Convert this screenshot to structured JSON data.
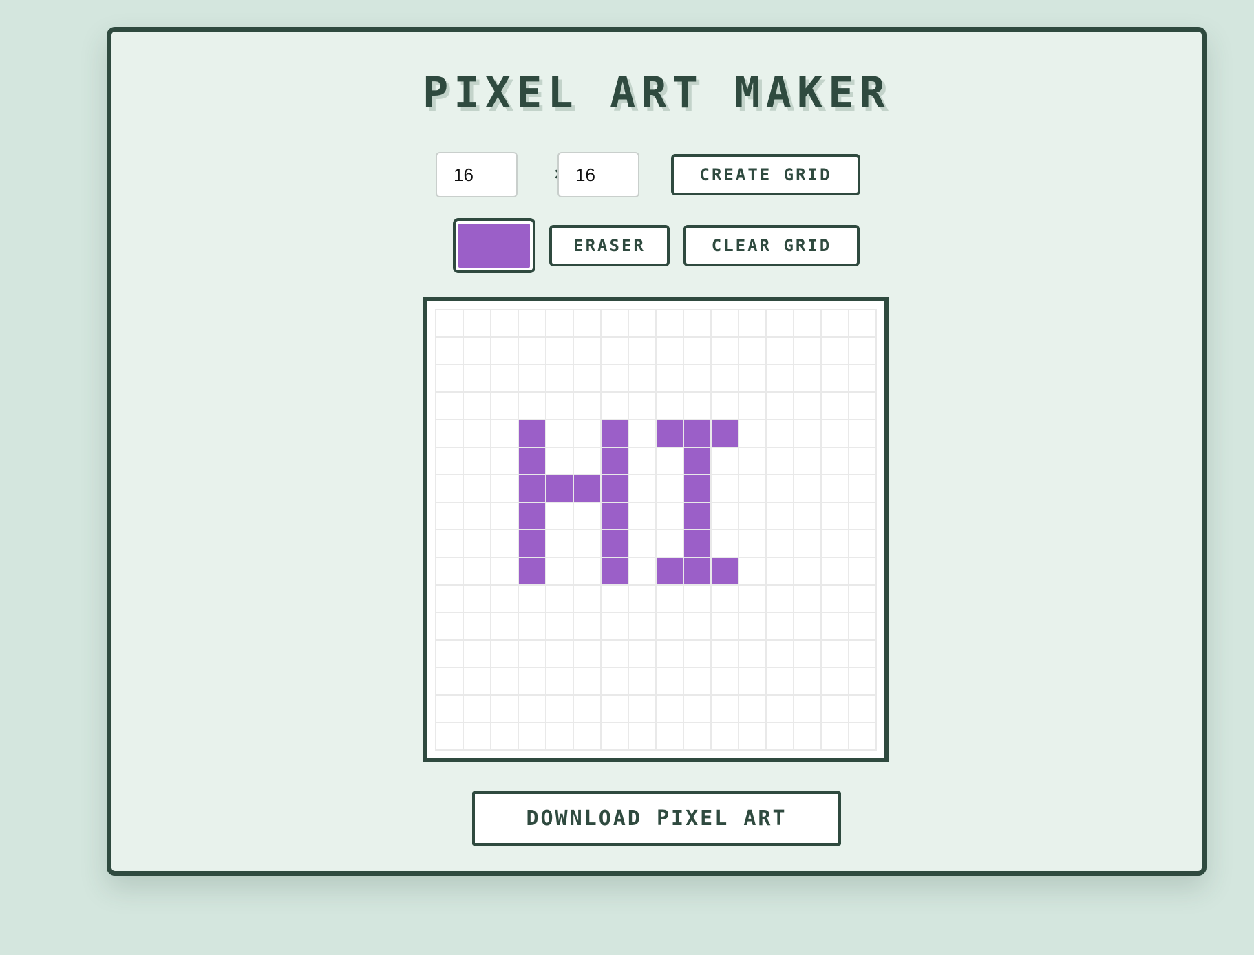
{
  "app": {
    "title": "PIXEL ART MAKER"
  },
  "controls": {
    "width_value": "16",
    "height_value": "16",
    "times_symbol": "×",
    "create_label": "CREATE GRID",
    "eraser_label": "ERASER",
    "clear_label": "CLEAR GRID",
    "download_label": "DOWNLOAD PIXEL ART",
    "selected_color": "#9b5fc8"
  },
  "grid": {
    "rows": 16,
    "cols": 16,
    "empty_color": "#ffffff",
    "line_color": "#e9e9e9",
    "painted_color": "#9b5fc8",
    "painted_cells": [
      [
        4,
        3
      ],
      [
        4,
        6
      ],
      [
        4,
        8
      ],
      [
        4,
        9
      ],
      [
        4,
        10
      ],
      [
        5,
        3
      ],
      [
        5,
        6
      ],
      [
        5,
        9
      ],
      [
        6,
        3
      ],
      [
        6,
        4
      ],
      [
        6,
        5
      ],
      [
        6,
        6
      ],
      [
        6,
        9
      ],
      [
        7,
        3
      ],
      [
        7,
        6
      ],
      [
        7,
        9
      ],
      [
        8,
        3
      ],
      [
        8,
        6
      ],
      [
        8,
        9
      ],
      [
        9,
        3
      ],
      [
        9,
        6
      ],
      [
        9,
        8
      ],
      [
        9,
        9
      ],
      [
        9,
        10
      ]
    ]
  },
  "colors": {
    "background": "#d4e6de",
    "panel": "#e8f2ec",
    "accent": "#2f4a3f"
  }
}
